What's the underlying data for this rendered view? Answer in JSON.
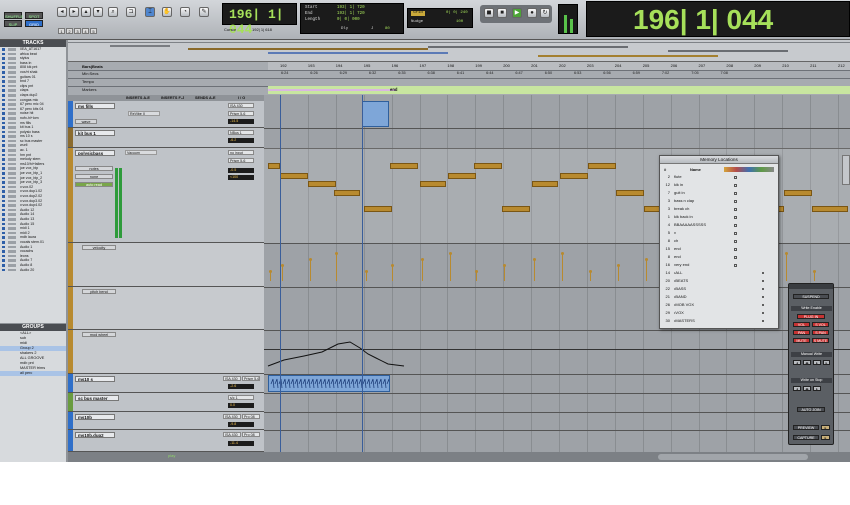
{
  "toolbar": {
    "modes": [
      "SHUFFLE",
      "SPOT",
      "SLIP",
      "GRID"
    ],
    "zoom_presets": [
      "1",
      "2",
      "3",
      "4",
      "5"
    ],
    "cursor_label": "Cursor",
    "cursor_value": "192| 1| 618",
    "main_counter": "196| 1| 044",
    "start_label": "Start",
    "end_label": "End",
    "length_label": "Length",
    "start_value": "193| 1| 720",
    "end_value": "193| 1| 720",
    "length_value": "0| 0| 000",
    "dly_label": "Dly",
    "grid_label": "Grid",
    "grid_value": "0| 0| 240",
    "nudge_label": "Nudge",
    "nudge_value": "100",
    "tempo_label": "J",
    "tempo_value": "80",
    "big_counter": "196| 1| 044"
  },
  "tracks_panel": {
    "header": "TRACKS",
    "items": [
      "0EA_AT1617",
      "africa beat",
      "stylus",
      "bass in",
      "808 kik pnt",
      "vox/rt shak",
      "guitars 01",
      "bnd 7",
      "clips pnt",
      "claps",
      "claps dup2",
      "congas mic",
      "67 perc mic 04",
      "67 perc kits 04",
      "noise hit",
      "nofx-hi+lom",
      "ms fills",
      "kit bus 1",
      "polysic bass",
      "ms 10 s",
      "sc bus master",
      "wurli",
      "ac. 1",
      "hm pnt",
      "melody stem",
      "ms10/hi+fallers",
      "joe vox_bip",
      "joe vox_bip_1",
      "joe vox_bip_2",
      "joe vox_bip_3",
      "v.vox.02",
      "v.vox.dup1.02",
      "v.vox.dup2.02",
      "v.vox.dup3.02",
      "v.vox.dup4.02",
      "Audio 12",
      "Audio 14",
      "Audio 13",
      "Audio 15",
      "midi 1",
      "midi 2",
      "mdb laura",
      "vocals stem.01",
      "Audio 1",
      "vocachs",
      "leons",
      "Audio 7",
      "Audio 8",
      "Audio 20"
    ]
  },
  "groups_panel": {
    "header": "GROUPS",
    "items": [
      "<ALL>",
      "sub",
      "midi",
      "Group 2",
      "shakers 2",
      "ALL GROOVE",
      "mdb pnt",
      "MASTER trims",
      "all perc"
    ]
  },
  "rulers": {
    "bars_label": "Bars|Beats",
    "mins_label": "Min:Secs",
    "tempo_label": "Tempo",
    "markers_label": "Markers",
    "bars": [
      "192",
      "193",
      "194",
      "195",
      "196",
      "197",
      "198",
      "199",
      "200",
      "201",
      "202",
      "203",
      "204",
      "205",
      "206",
      "207",
      "208",
      "209",
      "210",
      "211",
      "212"
    ],
    "times": [
      "6:24",
      "6:26",
      "6:29",
      "6:32",
      "6:35",
      "6:38",
      "6:41",
      "6:44",
      "6:47",
      "6:50",
      "6:53",
      "6:56",
      "6:59",
      "7:02",
      "7:05",
      "7:08"
    ],
    "marker_name": "end"
  },
  "edit_columns": {
    "inserts_ae": "INSERTS A-E",
    "inserts_fj": "INSERTS F-J",
    "sends_ae": "SENDS A-E",
    "io": "I / O"
  },
  "tracks": [
    {
      "name": "ms fills",
      "lane": "wave",
      "insert": "ReVibe II",
      "input": "ISA 430",
      "output": "Prism 5-6",
      "vol": "-14.5",
      "pan": "0"
    },
    {
      "name": "kit bus 1",
      "input": "NBus 1",
      "output": "Pro 12",
      "vol": "-6.2",
      "pan": "0"
    },
    {
      "name": "polysicbass",
      "lane": "notes",
      "lane2": "none",
      "lane3": "auto read",
      "insert": "Vacuum",
      "input": "no input",
      "output": "Prism 5-6",
      "vol": "-0.5",
      "pan": "<100"
    },
    {
      "name": "velocity"
    },
    {
      "name": "pitch bend"
    },
    {
      "name": "mod wheel"
    },
    {
      "name": "ms10 s",
      "input": "ISA 430",
      "output": "Prism 5-6",
      "vol": "-2.6"
    },
    {
      "name": "sc bus master",
      "input": "s/c 1",
      "vol": "0.0"
    },
    {
      "name": "ms10b",
      "input": "ISA 430",
      "output": "Pro 08",
      "vol": "-9.8"
    },
    {
      "name": "ms10b.dup2",
      "input": "ISA 430",
      "output": "Pro 08",
      "vol": "-11.4"
    }
  ],
  "memory_locations": {
    "title": "Memory Locations",
    "col_num": "#",
    "col_name": "Name",
    "rows": [
      {
        "num": "2",
        "name": "flute",
        "sel": false
      },
      {
        "num": "12",
        "name": "kik in",
        "sel": false
      },
      {
        "num": "7",
        "name": "guit in",
        "sel": false
      },
      {
        "num": "3",
        "name": "bass n clap",
        "sel": false
      },
      {
        "num": "3",
        "name": "break ch",
        "sel": false
      },
      {
        "num": "1",
        "name": "kik back in",
        "sel": false
      },
      {
        "num": "4",
        "name": "BBAAAAASSSSS",
        "sel": false
      },
      {
        "num": "5",
        "name": "v",
        "sel": false
      },
      {
        "num": "8",
        "name": "ch",
        "sel": false
      },
      {
        "num": "15",
        "name": "end",
        "sel": false
      },
      {
        "num": "8",
        "name": "end",
        "sel": false
      },
      {
        "num": "16",
        "name": "very end",
        "sel": false
      },
      {
        "num": "14",
        "name": "•ALL",
        "sel": true
      },
      {
        "num": "20",
        "name": "•BEATS",
        "sel": true
      },
      {
        "num": "22",
        "name": "•BASS",
        "sel": true
      },
      {
        "num": "21",
        "name": "•BAND",
        "sel": true
      },
      {
        "num": "26",
        "name": "•MOB VOX",
        "sel": true
      },
      {
        "num": "29",
        "name": "•VOX",
        "sel": true
      },
      {
        "num": "30",
        "name": "•MASTERS",
        "sel": true
      }
    ]
  },
  "automation": {
    "suspend": "SUSPEND",
    "write_enable": "Write Enable",
    "plug_in": "PLUG IN",
    "vol": "VOL",
    "s_vol": "S VOL",
    "pan": "PAN",
    "s_pan": "S PAN",
    "mute": "MUTE",
    "s_mute": "S MUTE",
    "manual_write": "Manual Write",
    "write_on_stop": "Write on Stop",
    "auto_join": "AUTO JOIN",
    "preview": "PREVIEW",
    "capture": "CAPTURE"
  },
  "clip_label": "play",
  "colors": {
    "midi_note": "#b88a2f",
    "region_blue": "#7ea6d8",
    "counter_green": "#a6e05a",
    "marker_green": "#c8e6a0",
    "purple_band": "#d9b6e0"
  }
}
